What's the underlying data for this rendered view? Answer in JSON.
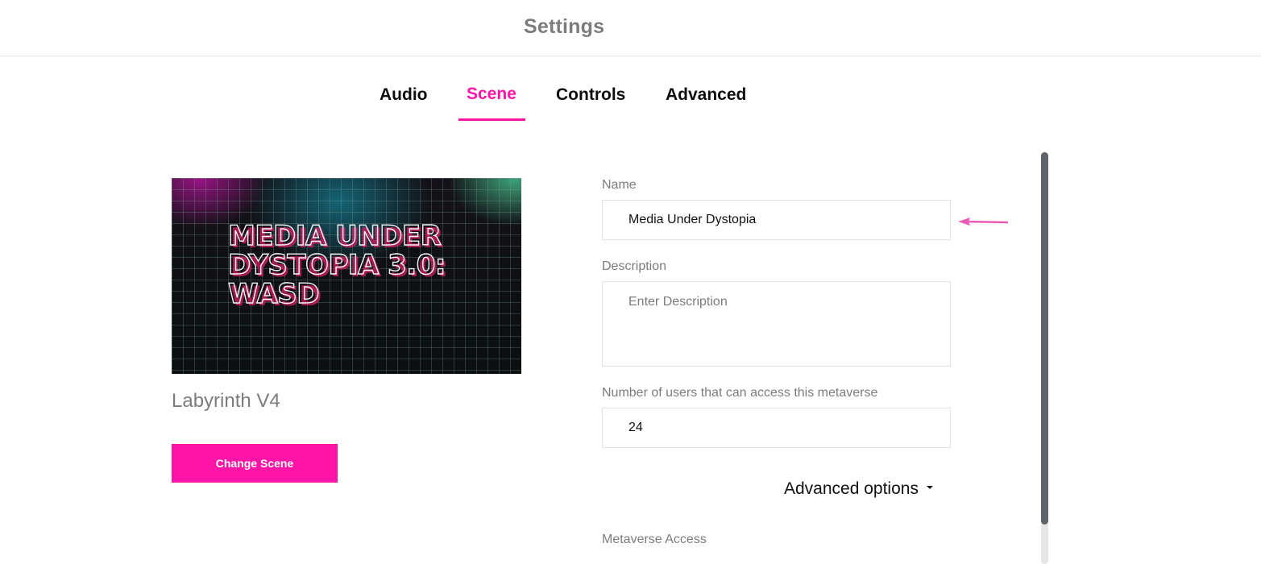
{
  "header": {
    "title": "Settings"
  },
  "tabs": [
    {
      "label": "Audio",
      "active": false
    },
    {
      "label": "Scene",
      "active": true
    },
    {
      "label": "Controls",
      "active": false
    },
    {
      "label": "Advanced",
      "active": false
    }
  ],
  "scene": {
    "thumbnail_text": "MEDIA UNDER\nDYSTOPIA 3.0:\nWASD",
    "name": "Labyrinth V4",
    "change_button_label": "Change Scene"
  },
  "form": {
    "name_label": "Name",
    "name_value": "Media Under Dystopia",
    "description_label": "Description",
    "description_value": "",
    "description_placeholder": "Enter Description",
    "users_label": "Number of users that can access this metaverse",
    "users_value": "24",
    "advanced_options_label": "Advanced options",
    "metaverse_access_label": "Metaverse Access"
  },
  "colors": {
    "accent": "#ff14a8",
    "muted_text": "#7c7c7c",
    "arrow": "#e95bb4"
  }
}
